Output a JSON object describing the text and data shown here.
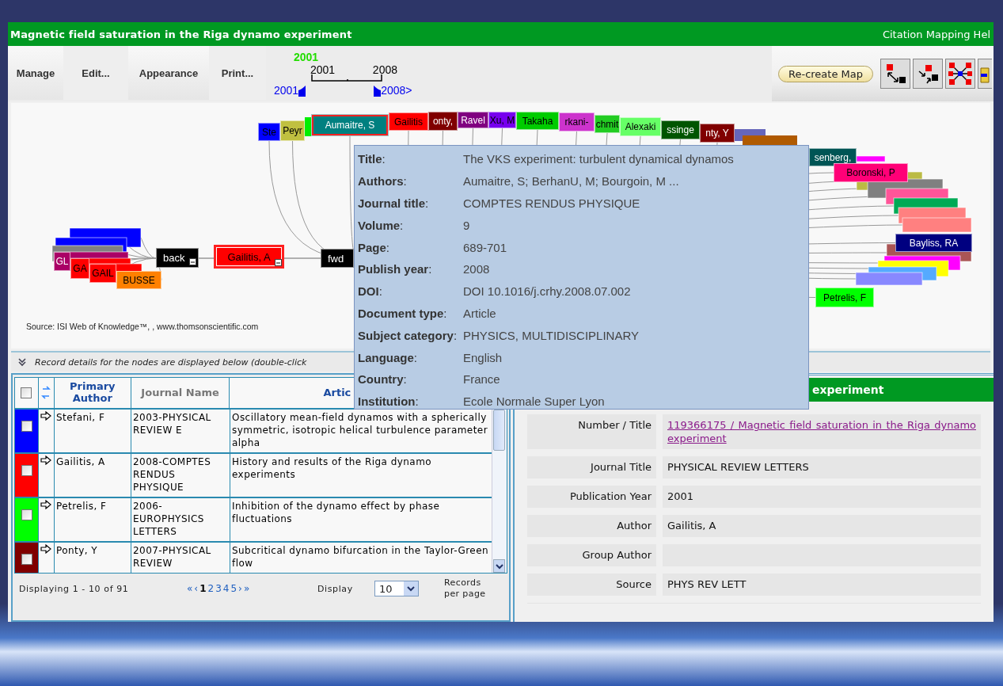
{
  "window": {
    "title": "Magnetic field saturation in the Riga dynamo experiment",
    "help_link": "Citation Mapping Hel"
  },
  "menu": [
    "Manage",
    "Edit...",
    "Appearance",
    "Print..."
  ],
  "timeline": {
    "current_year": "2001",
    "scale_start": "2001",
    "scale_end": "2008",
    "range_start": "2001",
    "range_end": "2008>"
  },
  "recreate_button": "Re-create Map",
  "map": {
    "nodes": [
      {
        "label": "GL",
        "color": "#aa0066",
        "selected": false
      },
      {
        "label": "GA",
        "color": "#ff0000",
        "selected": false
      },
      {
        "label": "GAIL",
        "color": "#ff0000",
        "selected": false
      },
      {
        "label": "BUSSE",
        "color": "#ff8000",
        "selected": false
      },
      {
        "label": "Ste",
        "color": "#0000ff",
        "selected": false
      },
      {
        "label": "Peyr",
        "color": "#c0c040",
        "selected": false
      },
      {
        "label": "Aumaitre, S",
        "color": "#008080",
        "selected": true
      },
      {
        "label": "Gailitis",
        "color": "#ff0000",
        "selected": false
      },
      {
        "label": "onty,",
        "color": "#800000",
        "selected": false
      },
      {
        "label": "Ravel",
        "color": "#800080",
        "selected": false
      },
      {
        "label": "Xu, M",
        "color": "#7700ee",
        "selected": false
      },
      {
        "label": "Takaha",
        "color": "#00cc00",
        "selected": false
      },
      {
        "label": "rkani-",
        "color": "#cc33cc",
        "selected": false
      },
      {
        "label": "chmit",
        "color": "#22cc22",
        "selected": false
      },
      {
        "label": "Alexaki",
        "color": "#66ff66",
        "selected": false
      },
      {
        "label": "ssinge",
        "color": "#005500",
        "selected": false
      },
      {
        "label": "nty, Y",
        "color": "#800000",
        "selected": false
      },
      {
        "label": "senberg,",
        "color": "#005555",
        "selected": false
      },
      {
        "label": "Boronski, P",
        "color": "#ff0077",
        "selected": false
      },
      {
        "label": "Bayliss, RA",
        "color": "#000080",
        "selected": false
      },
      {
        "label": "Petrelis, F",
        "color": "#00ff00",
        "selected": false
      }
    ],
    "nav": [
      {
        "label": "back",
        "expanded": true
      },
      {
        "label": "fwd",
        "expanded": false
      }
    ],
    "focus": {
      "label": "Gailitis, A",
      "color": "#ff0000",
      "expanded": true
    },
    "source": "Source: ISI Web of Knowledge™, , www.thomsonscientific.com"
  },
  "details_bar": "Record details for the nodes are displayed below (double-click",
  "tooltip": {
    "fields": [
      {
        "label": "**Title**:",
        "value": "The VKS experiment: turbulent dynamical dynamos"
      },
      {
        "label": "**Authors**:",
        "value": "Aumaitre, S; BerhanU, M; Bourgoin, M ..."
      },
      {
        "label": "**Journal title**:",
        "value": "COMPTES RENDUS PHYSIQUE"
      },
      {
        "label": "**Volume**:",
        "value": "9"
      },
      {
        "label": "**Page**:",
        "value": "689-701"
      },
      {
        "label": "**Publish year**:",
        "value": "2008"
      },
      {
        "label": "**DOI**:",
        "value": "DOI 10.1016/j.crhy.2008.07.002"
      },
      {
        "label": "**Document type**:",
        "value": "Article"
      },
      {
        "label": "**Subject category**:",
        "value": "PHYSICS, MULTIDISCIPLINARY"
      },
      {
        "label": "**Language**:",
        "value": "English"
      },
      {
        "label": "**Country**:",
        "value": "France"
      },
      {
        "label": "**Institution**:",
        "value": "Ecole Normale Super Lyon"
      }
    ]
  },
  "table": {
    "select_all": {
      "checked": false
    },
    "columns": [
      "Primary Author",
      "Journal Name",
      "Artic"
    ],
    "rows": [
      {
        "color": "#0000ff",
        "checked": false,
        "author": "Stefani, F",
        "journal": "2003-PHYSICAL REVIEW E",
        "title": "Oscillatory mean-field dynamos with a spherically symmetric, isotropic helical turbulence parameter alpha"
      },
      {
        "color": "#ff0000",
        "checked": false,
        "author": "Gailitis, A",
        "journal": "2008-COMPTES RENDUS PHYSIQUE",
        "title": "History and results of the Riga dynamo experiments"
      },
      {
        "color": "#00ff00",
        "checked": false,
        "author": "Petrelis, F",
        "journal": "2006-EUROPHYSICS LETTERS",
        "title": "Inhibition of the dynamo effect by phase fluctuations"
      },
      {
        "color": "#800000",
        "checked": false,
        "author": "Ponty, Y",
        "journal": "2007-PHYSICAL REVIEW",
        "title": "Subcritical dynamo bifurcation in the Taylor-Green flow"
      }
    ]
  },
  "pager": {
    "summary": "Displaying 1 - 10 of 91",
    "links": [
      {
        "label": "«",
        "selected": false
      },
      {
        "label": "‹",
        "selected": false
      },
      {
        "label": "1",
        "selected": true
      },
      {
        "label": "2",
        "selected": false
      },
      {
        "label": "3",
        "selected": false
      },
      {
        "label": "4",
        "selected": false
      },
      {
        "label": "5",
        "selected": false
      },
      {
        "label": "›",
        "selected": false
      },
      {
        "label": "»",
        "selected": false
      }
    ],
    "display_label": "Display",
    "page_size": "10",
    "per_page_label": "Records per page"
  },
  "record": {
    "header": "experiment",
    "fields": [
      {
        "label": "Number / Title",
        "value": "119366175 / Magnetic field saturation in the Riga dynamo experiment",
        "kind": "link"
      },
      {
        "label": "Journal Title",
        "value": "PHYSICAL REVIEW LETTERS",
        "kind": "text"
      },
      {
        "label": "Publication Year",
        "value": "2001",
        "kind": "text"
      },
      {
        "label": "Author",
        "value": "Gailitis, A",
        "kind": "text"
      },
      {
        "label": "Group Author",
        "kind": "text"
      },
      {
        "label": "Source",
        "value": "PHYS REV LETT",
        "kind": "text"
      }
    ]
  }
}
